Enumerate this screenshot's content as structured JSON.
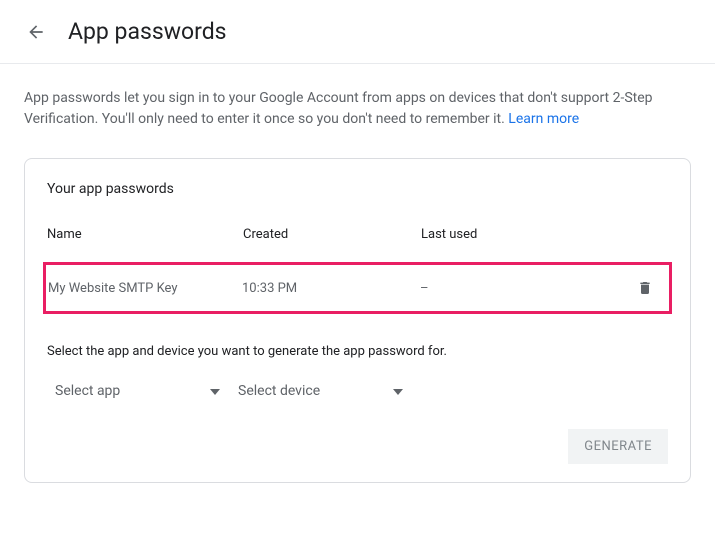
{
  "header": {
    "title": "App passwords"
  },
  "description": {
    "text": "App passwords let you sign in to your Google Account from apps on devices that don't support 2-Step Verification. You'll only need to enter it once so you don't need to remember it.",
    "learn_more": "Learn more"
  },
  "card": {
    "title": "Your app passwords",
    "columns": {
      "name": "Name",
      "created": "Created",
      "last_used": "Last used"
    },
    "rows": [
      {
        "name": "My Website SMTP Key",
        "created": "10:33 PM",
        "last_used": "–"
      }
    ],
    "select_text": "Select the app and device you want to generate the app password for.",
    "select_app": "Select app",
    "select_device": "Select device",
    "generate": "GENERATE"
  }
}
